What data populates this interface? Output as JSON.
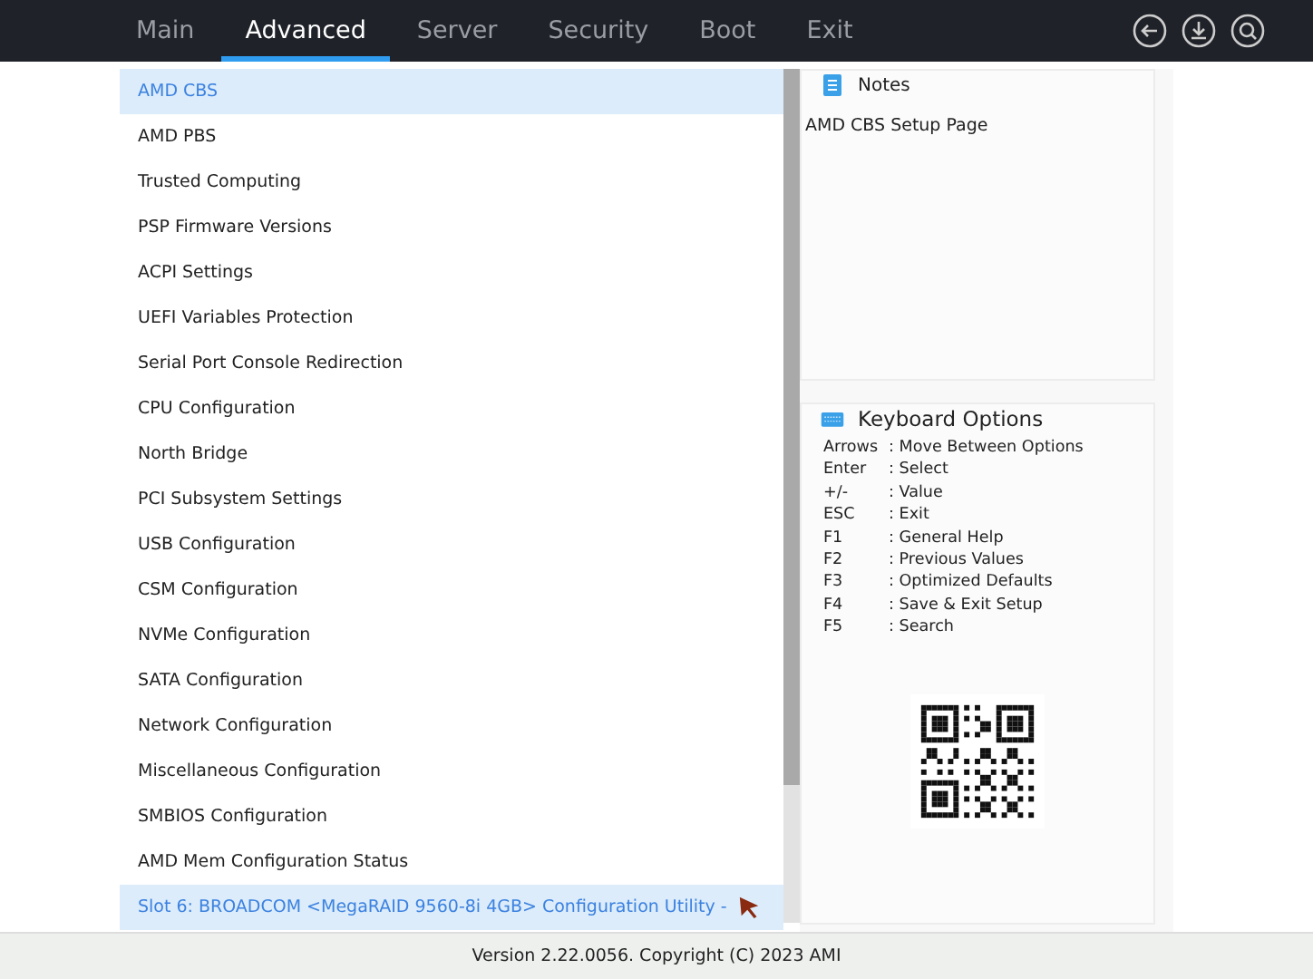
{
  "tabs": [
    {
      "label": "Main",
      "selected": false
    },
    {
      "label": "Advanced",
      "selected": true
    },
    {
      "label": "Server",
      "selected": false
    },
    {
      "label": "Security",
      "selected": false
    },
    {
      "label": "Boot",
      "selected": false
    },
    {
      "label": "Exit",
      "selected": false
    }
  ],
  "menu": [
    {
      "label": "AMD CBS",
      "highlighted": true
    },
    {
      "label": "AMD PBS",
      "highlighted": false
    },
    {
      "label": "Trusted Computing",
      "highlighted": false
    },
    {
      "label": "PSP Firmware Versions",
      "highlighted": false
    },
    {
      "label": "ACPI Settings",
      "highlighted": false
    },
    {
      "label": "UEFI Variables Protection",
      "highlighted": false
    },
    {
      "label": "Serial Port Console Redirection",
      "highlighted": false
    },
    {
      "label": "CPU Configuration",
      "highlighted": false
    },
    {
      "label": "North Bridge",
      "highlighted": false
    },
    {
      "label": "PCI Subsystem Settings",
      "highlighted": false
    },
    {
      "label": "USB Configuration",
      "highlighted": false
    },
    {
      "label": "CSM Configuration",
      "highlighted": false
    },
    {
      "label": "NVMe Configuration",
      "highlighted": false
    },
    {
      "label": "SATA Configuration",
      "highlighted": false
    },
    {
      "label": "Network Configuration",
      "highlighted": false
    },
    {
      "label": "Miscellaneous Configuration",
      "highlighted": false
    },
    {
      "label": "SMBIOS Configuration",
      "highlighted": false
    },
    {
      "label": "AMD Mem Configuration Status",
      "highlighted": false
    },
    {
      "label": "Slot 6: BROADCOM <MegaRAID 9560-8i 4GB> Configuration Utility -",
      "highlighted": true
    }
  ],
  "notes": {
    "title": "Notes",
    "text": "AMD CBS Setup Page"
  },
  "keyboard_options": {
    "title": "Keyboard Options",
    "items": [
      {
        "key": "Arrows",
        "action": ": Move Between Options"
      },
      {
        "key": "Enter",
        "action": ": Select"
      },
      {
        "key": "+/-",
        "action": ": Value"
      },
      {
        "key": "ESC",
        "action": ": Exit"
      },
      {
        "key": "F1",
        "action": ": General Help"
      },
      {
        "key": "F2",
        "action": ": Previous Values"
      },
      {
        "key": "F3",
        "action": ": Optimized Defaults"
      },
      {
        "key": "F4",
        "action": ": Save & Exit Setup"
      },
      {
        "key": "F5",
        "action": ": Search"
      }
    ]
  },
  "status_bar": "Version 2.22.0056. Copyright (C) 2023 AMI"
}
